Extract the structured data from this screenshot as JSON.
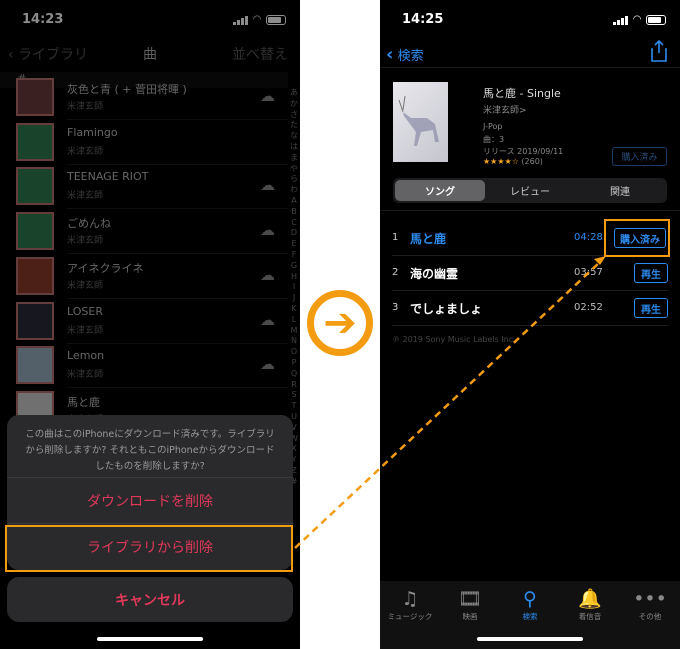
{
  "left": {
    "time": "14:23",
    "nav": {
      "back": "ライブラリ",
      "title": "曲",
      "sort": "並べ替え"
    },
    "section": "#",
    "songs": [
      {
        "title": "灰色と青 ( + 菅田将暉 )",
        "artist": "米津玄師",
        "cloud": true
      },
      {
        "title": "Flamingo",
        "artist": "米津玄師",
        "cloud": false
      },
      {
        "title": "TEENAGE RIOT",
        "artist": "米津玄師",
        "cloud": true
      },
      {
        "title": "ごめんね",
        "artist": "米津玄師",
        "cloud": true
      },
      {
        "title": "アイネクライネ",
        "artist": "米津玄師",
        "cloud": true
      },
      {
        "title": "LOSER",
        "artist": "米津玄師",
        "cloud": true
      },
      {
        "title": "Lemon",
        "artist": "米津玄師",
        "cloud": true
      },
      {
        "title": "馬と鹿",
        "artist": "米津玄師",
        "cloud": false
      }
    ],
    "index": "あかさたなはまやらわABCDEFGHIJKLMNOPQRSTUVWXYZ#",
    "sheet": {
      "message": "この曲はこのiPhoneにダウンロード済みです。ライブラリから削除しますか? それともこのiPhoneからダウンロードしたものを削除しますか?",
      "remove_download": "ダウンロードを削除",
      "remove_library": "ライブラリから削除",
      "cancel": "キャンセル"
    }
  },
  "right": {
    "time": "14:25",
    "nav": {
      "back": "検索"
    },
    "album": {
      "title": "馬と鹿 - Single",
      "artist": "米津玄師>",
      "genre": "J-Pop",
      "count": "曲：3",
      "release": "リリース 2019/09/11",
      "stars": "★★★★☆",
      "rating": 4.5,
      "reviews": "(260)",
      "purchased": "購入済み"
    },
    "segments": [
      "ソング",
      "レビュー",
      "関連"
    ],
    "tracks": [
      {
        "num": "1",
        "title": "馬と鹿",
        "duration": "04:28",
        "button": "購入済み"
      },
      {
        "num": "2",
        "title": "海の幽霊",
        "duration": "03:57",
        "button": "再生"
      },
      {
        "num": "3",
        "title": "でしょましょ",
        "duration": "02:52",
        "button": "再生"
      }
    ],
    "copyright": "℗ 2019 Sony Music Labels Inc.",
    "tabs": [
      {
        "label": "ミュージック",
        "icon": "music-note-icon",
        "glyph": "♫"
      },
      {
        "label": "映画",
        "icon": "film-icon",
        "glyph": "🎞"
      },
      {
        "label": "検索",
        "icon": "search-icon",
        "glyph": "⚲"
      },
      {
        "label": "着信音",
        "icon": "bell-icon",
        "glyph": "🔔"
      },
      {
        "label": "その他",
        "icon": "more-icon",
        "glyph": "•••"
      }
    ]
  },
  "colors": {
    "accent": "#2d8cf0",
    "destructive": "#e0385a",
    "highlight": "#f39c12"
  }
}
